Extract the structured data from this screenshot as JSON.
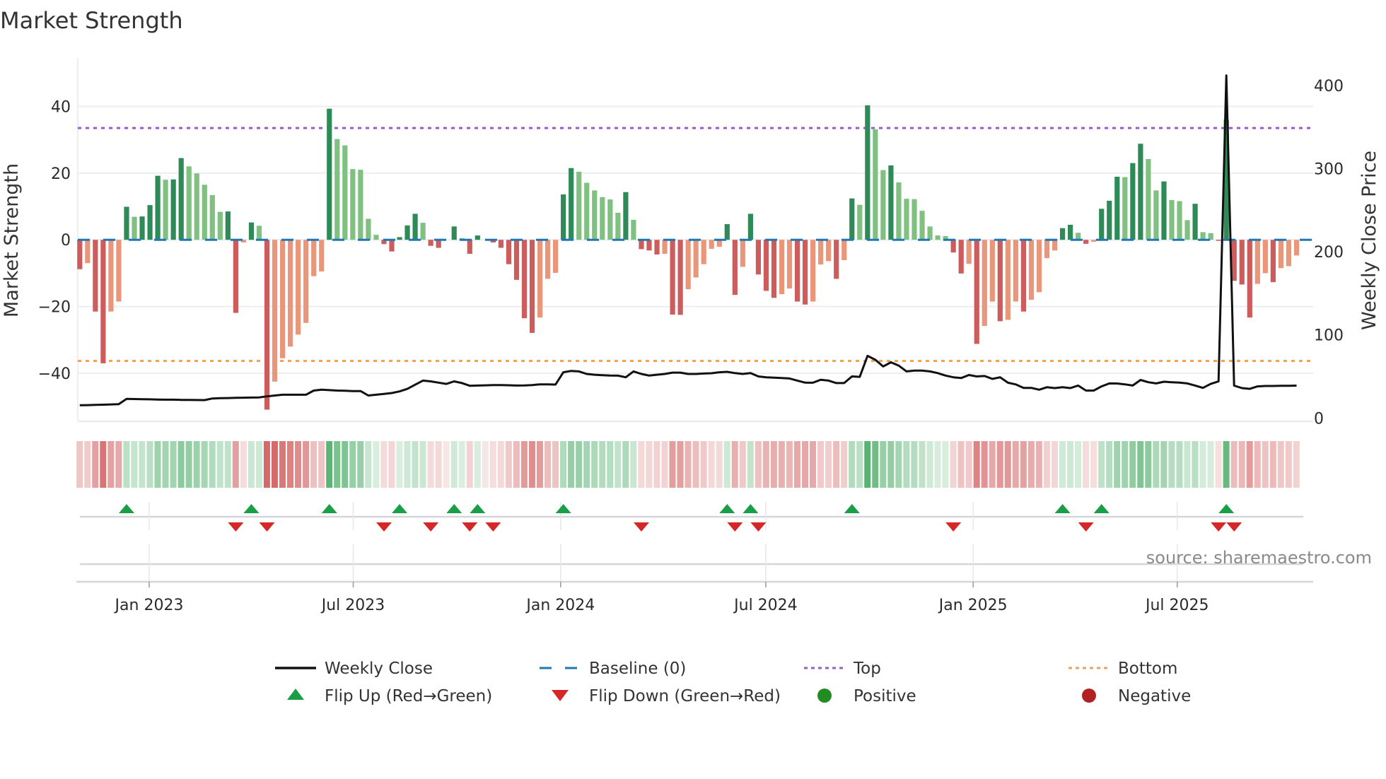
{
  "title": "Market Strength",
  "source": "source: sharemaestro.com",
  "chart_data": {
    "type": "bar",
    "title": "Market Strength",
    "ylabel": "Market Strength",
    "y2label": "Weekly Close Price",
    "ylim": [
      -54.4,
      54.5
    ],
    "y2lim": [
      -4,
      433
    ],
    "x_start": "2022-10-31",
    "x_step_days": 7,
    "yticks": [
      {
        "v": 40,
        "label": "40"
      },
      {
        "v": 20,
        "label": "20"
      },
      {
        "v": 0,
        "label": "0"
      },
      {
        "v": -20,
        "label": "−20"
      },
      {
        "v": -40,
        "label": "−40"
      }
    ],
    "y2ticks": [
      {
        "v": 400,
        "label": "400"
      },
      {
        "v": 300,
        "label": "300"
      },
      {
        "v": 200,
        "label": "200"
      },
      {
        "v": 100,
        "label": "100"
      },
      {
        "v": 0,
        "label": "0"
      }
    ],
    "xticks": [
      {
        "date": "2023-01-01",
        "label": "Jan 2023"
      },
      {
        "date": "2023-07-01",
        "label": "Jul 2023"
      },
      {
        "date": "2024-01-01",
        "label": "Jan 2024"
      },
      {
        "date": "2024-07-01",
        "label": "Jul 2024"
      },
      {
        "date": "2025-01-01",
        "label": "Jan 2025"
      },
      {
        "date": "2025-07-01",
        "label": "Jul 2025"
      }
    ],
    "top_level": 33.5,
    "bottom_level": -36.3,
    "baseline": 0,
    "strength": [
      -8.8,
      -7,
      -21.5,
      -37,
      -21.5,
      -18.5,
      9.9,
      6.9,
      7.0,
      10.4,
      19.2,
      18,
      18.1,
      24.5,
      22,
      19.9,
      16.5,
      13.4,
      8.4,
      8.5,
      -21.9,
      -0.8,
      5.2,
      4.2,
      -50.9,
      -42.5,
      -35.5,
      -32,
      -28.4,
      -24.9,
      -10.9,
      -9.5,
      39.3,
      30.2,
      28.3,
      21.2,
      21,
      6.3,
      1.5,
      -1.3,
      -3.5,
      0.8,
      4.3,
      7.8,
      5.1,
      -1.8,
      -2.4,
      0,
      4,
      0.5,
      -4.2,
      1.3,
      0,
      -0.8,
      -2.4,
      -7.3,
      -12,
      -23.5,
      -27.9,
      -23.3,
      -11.7,
      -9.9,
      13.6,
      21.5,
      20.4,
      17.1,
      14.8,
      12.8,
      12.1,
      8.1,
      14.3,
      6,
      -2.8,
      -3.2,
      -4.4,
      -4.2,
      -22.4,
      -22.5,
      -14.8,
      -11.3,
      -7.3,
      -2.7,
      -2.1,
      4.7,
      -16.5,
      -8.1,
      7.8,
      -10.4,
      -15.3,
      -17.4,
      -16.3,
      -14.6,
      -18.5,
      -19.4,
      -18.5,
      -7.4,
      -6.4,
      -11.7,
      -6.1,
      12.4,
      10.5,
      40.3,
      33.1,
      20.9,
      22.3,
      17.2,
      12.3,
      12.2,
      8.7,
      4,
      1.3,
      1.1,
      -3.8,
      -10.1,
      -7.2,
      -31.2,
      -25.8,
      -18.5,
      -24.4,
      -24,
      -18.5,
      -21.5,
      -18,
      -15.7,
      -5.5,
      -3.2,
      3.5,
      4.5,
      2.1,
      -1.2,
      -0.6,
      9.3,
      11.7,
      18.9,
      18.8,
      23,
      28.8,
      24.2,
      14.8,
      17.5,
      11.9,
      11.6,
      5.9,
      10.8,
      2.3,
      2,
      -0.3,
      36,
      -12.3,
      -13.4,
      -23.3,
      -13.2,
      -10,
      -12.7,
      -8.5,
      -7.9,
      -4.7
    ],
    "weekly_close": [
      15.3,
      15.5,
      15.7,
      16,
      16.3,
      16.7,
      23,
      22.8,
      22.6,
      22.4,
      22.2,
      22,
      22,
      21.8,
      21.7,
      21.6,
      21.5,
      23.5,
      23.8,
      24,
      24.2,
      24.4,
      24.6,
      24.7,
      26,
      27,
      28,
      28,
      28,
      28,
      33,
      34,
      33.5,
      33,
      32.7,
      32.4,
      32.4,
      27,
      28,
      29,
      30,
      32,
      35,
      40,
      45,
      44,
      42.5,
      41,
      44,
      42,
      38.8,
      39,
      39.3,
      39.5,
      39.6,
      39.4,
      39,
      39.2,
      39.6,
      40.5,
      40.4,
      40.2,
      55,
      56.6,
      56,
      53,
      52,
      51.5,
      51,
      50.9,
      49,
      56,
      53,
      51,
      52,
      53,
      54.6,
      54.6,
      53,
      53,
      53.5,
      53.8,
      55,
      55.5,
      54,
      53,
      54,
      50,
      49,
      48.5,
      48,
      47.5,
      45,
      42.5,
      42.4,
      46,
      45,
      42,
      42,
      50,
      49.5,
      74.7,
      70,
      62,
      67,
      63,
      56,
      57,
      57,
      56,
      54,
      51,
      49,
      48,
      51.7,
      50,
      50.5,
      47,
      49,
      42.4,
      40.4,
      36.2,
      36.2,
      34,
      37,
      36,
      37,
      36,
      39,
      33,
      33,
      38,
      41.6,
      41.5,
      40.5,
      39,
      45.7,
      43,
      41.6,
      43.6,
      43,
      42.5,
      41.6,
      39,
      36.2,
      41,
      44,
      412,
      38.9,
      36,
      35,
      38,
      38.5,
      38.5,
      38.7,
      38.8,
      38.9
    ],
    "legend_position": "bottom",
    "legend": [
      {
        "key": "weekly_close",
        "label": "Weekly Close"
      },
      {
        "key": "baseline",
        "label": "Baseline (0)"
      },
      {
        "key": "top",
        "label": "Top"
      },
      {
        "key": "bottom",
        "label": "Bottom"
      },
      {
        "key": "flip_up",
        "label": "Flip Up (Red→Green)"
      },
      {
        "key": "flip_down",
        "label": "Flip Down (Green→Red)"
      },
      {
        "key": "positive",
        "label": "Positive"
      },
      {
        "key": "negative",
        "label": "Negative"
      }
    ]
  },
  "colors": {
    "pos_strong": "#2e8b57",
    "pos_weak": "#80c080",
    "neg_strong": "#cd5c5c",
    "neg_weak": "#e9967a",
    "baseline": "#1f77b4",
    "top": "#9b59d0",
    "bottom": "#f0a050",
    "flip_up": "#1a9e48",
    "flip_down": "#d62728",
    "positive_dot": "#228b22",
    "negative_dot": "#b22222",
    "line": "#111111"
  }
}
